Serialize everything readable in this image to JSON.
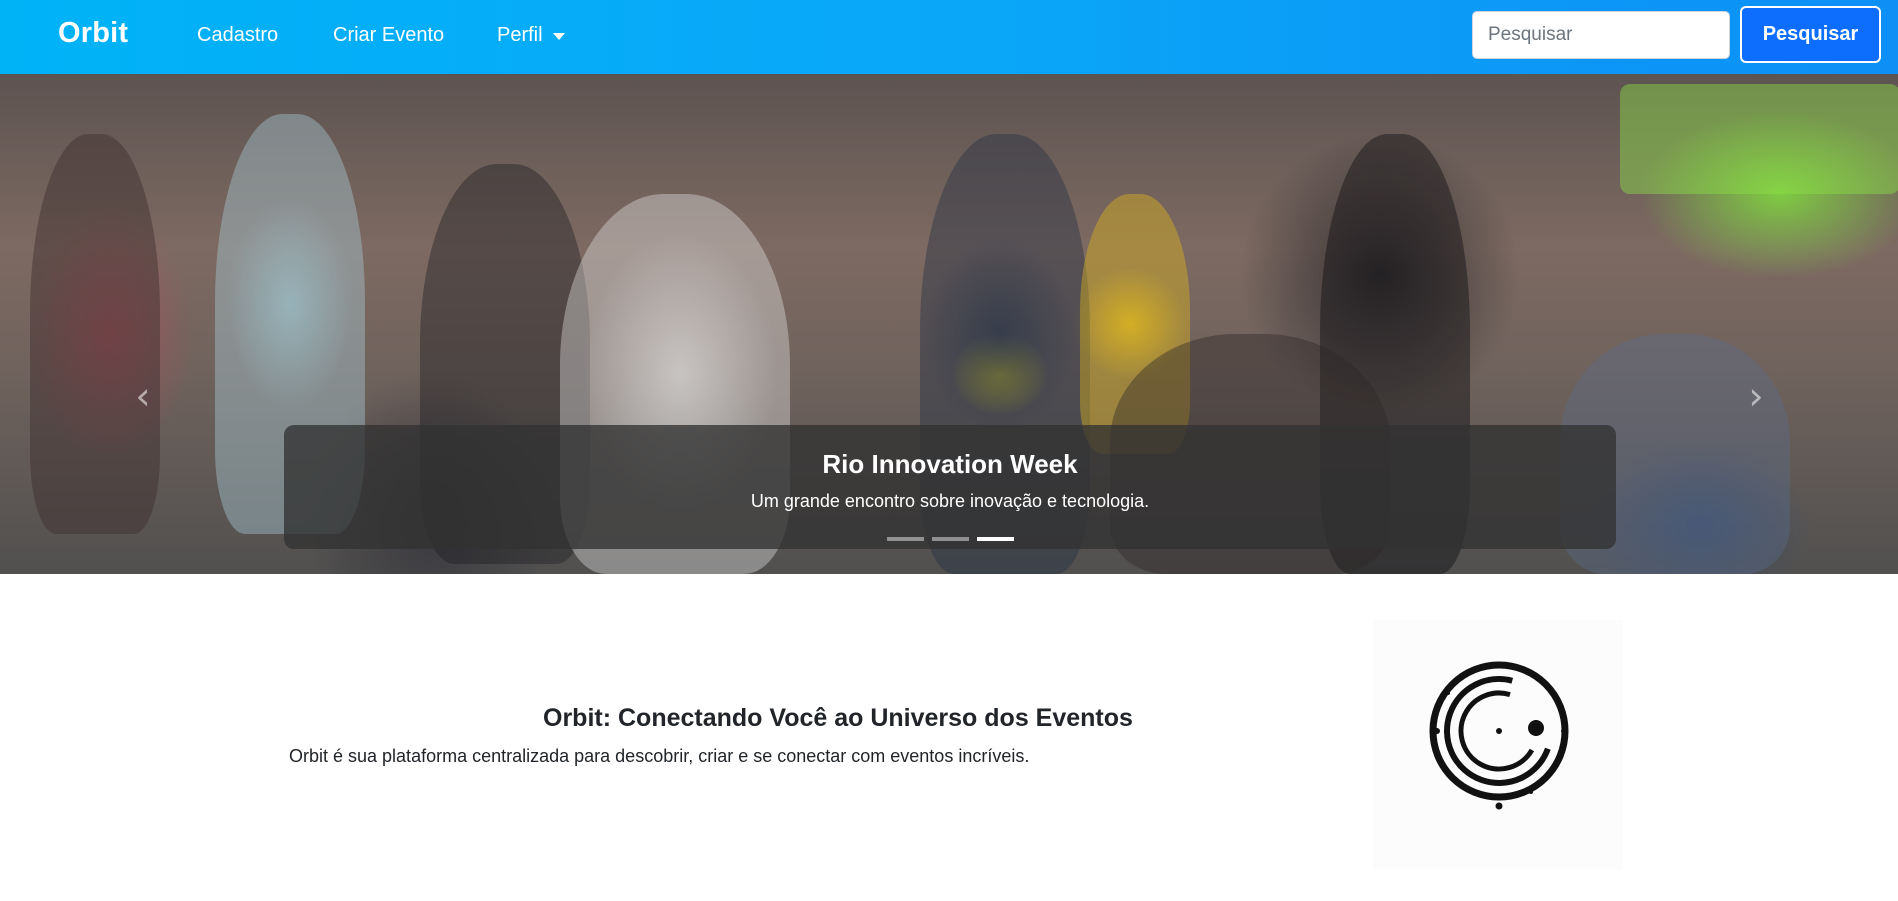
{
  "navbar": {
    "brand": "Orbit",
    "links": [
      {
        "label": "Cadastro"
      },
      {
        "label": "Criar Evento"
      },
      {
        "label": "Perfil"
      }
    ],
    "search": {
      "placeholder": "Pesquisar",
      "button_label": "Pesquisar"
    },
    "background": "#0aa7f8",
    "button_color": "#0d6efd"
  },
  "carousel": {
    "prev_icon": "chevron-left-icon",
    "next_icon": "chevron-right-icon",
    "caption": {
      "title": "Rio Innovation Week",
      "text": "Um grande encontro sobre inovação e tecnologia."
    },
    "slide_count": 3,
    "active_slide": 3
  },
  "about": {
    "title": "Orbit: Conectando Você ao Universo dos Eventos",
    "text": "Orbit é sua plataforma centralizada para descobrir, criar e se conectar com eventos incríveis.",
    "logo_icon": "orbit-logo-icon"
  }
}
